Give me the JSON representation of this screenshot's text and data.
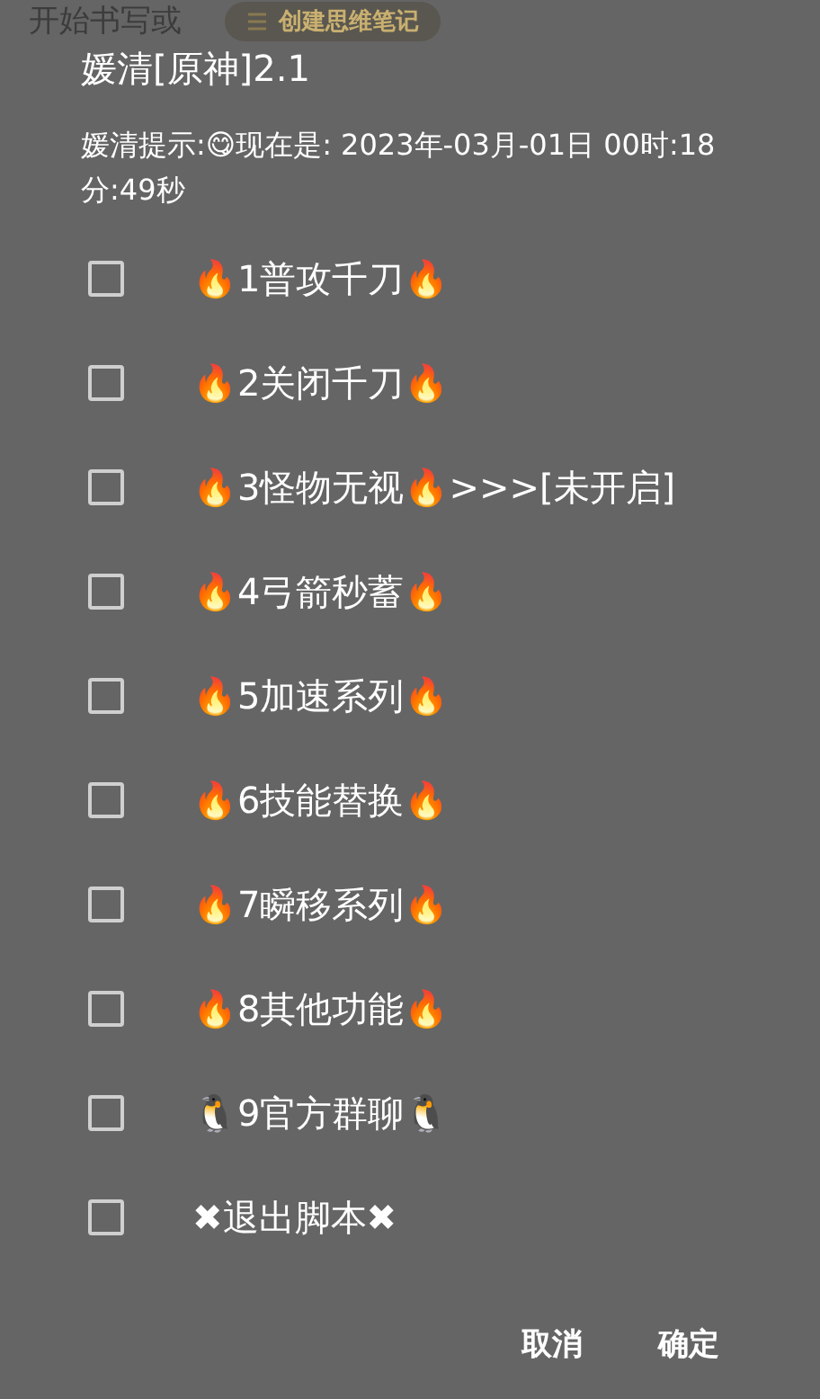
{
  "background": {
    "text": "开始书写或",
    "button": "创建思维笔记"
  },
  "dialog": {
    "title": "媛清[原神]2.1",
    "message": "媛清提示:😋现在是: 2023年-03月-01日 00时:18分:49秒",
    "options": [
      {
        "label": "🔥1普攻千刀🔥",
        "checked": false
      },
      {
        "label": "🔥2关闭千刀🔥",
        "checked": false
      },
      {
        "label": "🔥3怪物无视🔥>>>[未开启]",
        "checked": false
      },
      {
        "label": "🔥4弓箭秒蓄🔥",
        "checked": false
      },
      {
        "label": "🔥5加速系列🔥",
        "checked": false
      },
      {
        "label": "🔥6技能替换🔥",
        "checked": false
      },
      {
        "label": "🔥7瞬移系列🔥",
        "checked": false
      },
      {
        "label": "🔥8其他功能🔥",
        "checked": false
      },
      {
        "label": "🐧9官方群聊🐧",
        "checked": false
      },
      {
        "label": "✖退出脚本✖",
        "checked": false
      }
    ],
    "buttons": [
      "取消",
      "确定"
    ]
  }
}
